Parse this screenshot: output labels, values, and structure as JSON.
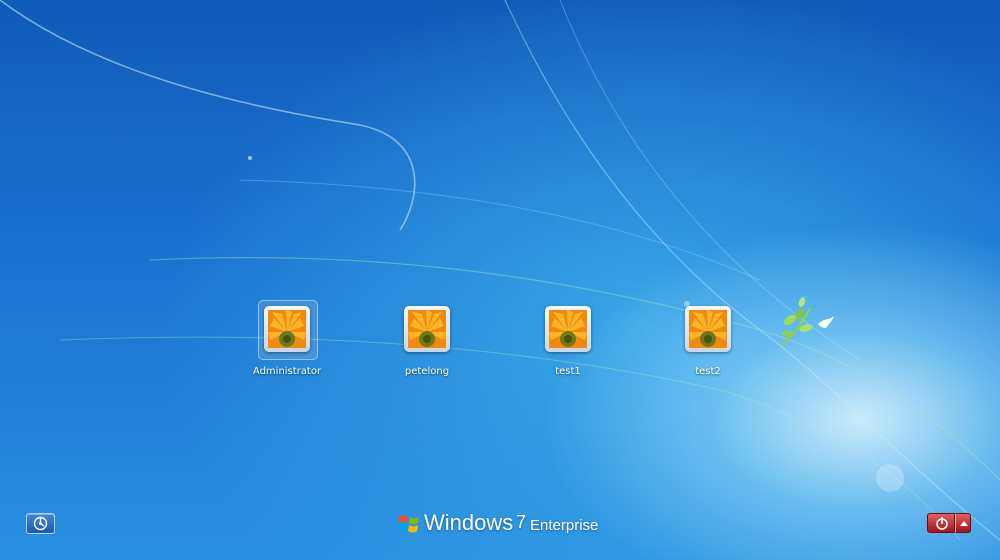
{
  "users": [
    {
      "name": "Administrator",
      "selected": true
    },
    {
      "name": "petelong",
      "selected": false
    },
    {
      "name": "test1",
      "selected": false
    },
    {
      "name": "test2",
      "selected": false
    }
  ],
  "branding": {
    "product": "Windows",
    "version": "7",
    "edition": "Enterprise"
  },
  "controls": {
    "ease_of_access_icon": "ease-of-access-icon",
    "shutdown_icon": "power-icon",
    "shutdown_options_icon": "chevron-up-icon"
  },
  "colors": {
    "background": "#1a72cf",
    "shutdown_button": "#b51c1c"
  }
}
